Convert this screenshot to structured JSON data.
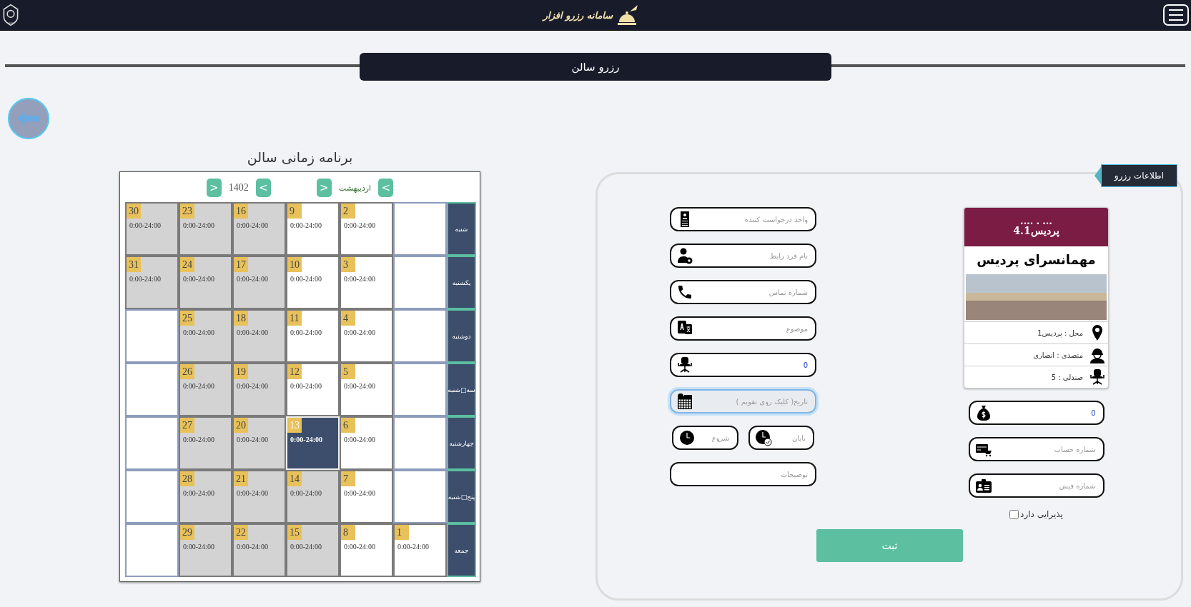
{
  "header": {
    "title": "سامانه رزرو افزار"
  },
  "page_title": "رزرو سالن",
  "schedule": {
    "title": "برنامه زمانی سالن",
    "month_picker": {
      "start_button": ">",
      "label": "اردیبهشت",
      "end_button": "<"
    },
    "year_picker": {
      "start_button": ">",
      "label": "1402",
      "end_button": "<"
    },
    "rows": [
      {
        "day_name": "شنبه",
        "cells": [
          {
            "kind": "blank"
          },
          {
            "kind": "day",
            "day": "2",
            "hours": "0:00-24:00",
            "past": false,
            "selected": false
          },
          {
            "kind": "day",
            "day": "9",
            "hours": "0:00-24:00",
            "past": false,
            "selected": false
          },
          {
            "kind": "day",
            "day": "16",
            "hours": "0:00-24:00",
            "past": true,
            "selected": false
          },
          {
            "kind": "day",
            "day": "23",
            "hours": "0:00-24:00",
            "past": true,
            "selected": false
          },
          {
            "kind": "day",
            "day": "30",
            "hours": "0:00-24:00",
            "past": true,
            "selected": false
          }
        ]
      },
      {
        "day_name": "یکشنبه",
        "cells": [
          {
            "kind": "blank"
          },
          {
            "kind": "day",
            "day": "3",
            "hours": "0:00-24:00",
            "past": false,
            "selected": false
          },
          {
            "kind": "day",
            "day": "10",
            "hours": "0:00-24:00",
            "past": false,
            "selected": false
          },
          {
            "kind": "day",
            "day": "17",
            "hours": "0:00-24:00",
            "past": true,
            "selected": false
          },
          {
            "kind": "day",
            "day": "24",
            "hours": "0:00-24:00",
            "past": true,
            "selected": false
          },
          {
            "kind": "day",
            "day": "31",
            "hours": "0:00-24:00",
            "past": true,
            "selected": false
          }
        ]
      },
      {
        "day_name": "دوشنبه",
        "cells": [
          {
            "kind": "blank"
          },
          {
            "kind": "day",
            "day": "4",
            "hours": "0:00-24:00",
            "past": false,
            "selected": false
          },
          {
            "kind": "day",
            "day": "11",
            "hours": "0:00-24:00",
            "past": false,
            "selected": false
          },
          {
            "kind": "day",
            "day": "18",
            "hours": "0:00-24:00",
            "past": true,
            "selected": false
          },
          {
            "kind": "day",
            "day": "25",
            "hours": "0:00-24:00",
            "past": true,
            "selected": false
          },
          {
            "kind": "blank"
          }
        ]
      },
      {
        "day_name": "سه□شنبه",
        "cells": [
          {
            "kind": "blank"
          },
          {
            "kind": "day",
            "day": "5",
            "hours": "0:00-24:00",
            "past": false,
            "selected": false
          },
          {
            "kind": "day",
            "day": "12",
            "hours": "0:00-24:00",
            "past": false,
            "selected": false
          },
          {
            "kind": "day",
            "day": "19",
            "hours": "0:00-24:00",
            "past": true,
            "selected": false
          },
          {
            "kind": "day",
            "day": "26",
            "hours": "0:00-24:00",
            "past": true,
            "selected": false
          },
          {
            "kind": "blank"
          }
        ]
      },
      {
        "day_name": "چهارشنبه",
        "cells": [
          {
            "kind": "blank"
          },
          {
            "kind": "day",
            "day": "6",
            "hours": "0:00-24:00",
            "past": false,
            "selected": false
          },
          {
            "kind": "day",
            "day": "13",
            "hours": "0:00-24:00",
            "past": false,
            "selected": true
          },
          {
            "kind": "day",
            "day": "20",
            "hours": "0:00-24:00",
            "past": true,
            "selected": false
          },
          {
            "kind": "day",
            "day": "27",
            "hours": "0:00-24:00",
            "past": true,
            "selected": false
          },
          {
            "kind": "blank"
          }
        ]
      },
      {
        "day_name": "پنج□شنبه",
        "cells": [
          {
            "kind": "blank"
          },
          {
            "kind": "day",
            "day": "7",
            "hours": "0:00-24:00",
            "past": false,
            "selected": false
          },
          {
            "kind": "day",
            "day": "14",
            "hours": "0:00-24:00",
            "past": true,
            "selected": false
          },
          {
            "kind": "day",
            "day": "21",
            "hours": "0:00-24:00",
            "past": true,
            "selected": false
          },
          {
            "kind": "day",
            "day": "28",
            "hours": "0:00-24:00",
            "past": true,
            "selected": false
          },
          {
            "kind": "blank"
          }
        ]
      },
      {
        "day_name": "جمعه",
        "cells": [
          {
            "kind": "day",
            "day": "1",
            "hours": "0:00-24:00",
            "past": false,
            "selected": false
          },
          {
            "kind": "day",
            "day": "8",
            "hours": "0:00-24:00",
            "past": false,
            "selected": false
          },
          {
            "kind": "day",
            "day": "15",
            "hours": "0:00-24:00",
            "past": true,
            "selected": false
          },
          {
            "kind": "day",
            "day": "22",
            "hours": "0:00-24:00",
            "past": true,
            "selected": false
          },
          {
            "kind": "day",
            "day": "29",
            "hours": "0:00-24:00",
            "past": true,
            "selected": false
          },
          {
            "kind": "blank"
          }
        ]
      }
    ]
  },
  "reservation": {
    "tab": "اطلاعات رزرو",
    "venue_card": {
      "code_dots": "... . ....",
      "code": "پردیس4.1",
      "name": "مهمانسرای پردیس",
      "details": [
        {
          "kind": "location",
          "text": "محل : پردیس1"
        },
        {
          "kind": "attendant",
          "text": "متصدی : انصاری"
        },
        {
          "kind": "seats",
          "text": "صندلی : 5"
        }
      ]
    },
    "side_fields": [
      {
        "kind": "amount",
        "value": "0"
      },
      {
        "kind": "account",
        "placeholder": "شماره حساب"
      },
      {
        "kind": "receipt",
        "placeholder": "شماره فیش"
      }
    ],
    "catering": {
      "label": "پذیرایی دارد",
      "checked": false
    },
    "form_fields": [
      {
        "kind": "unit",
        "placeholder": "واحد درخواست کننده"
      },
      {
        "kind": "contact",
        "placeholder": "نام فرد رابط"
      },
      {
        "kind": "phone",
        "placeholder": "شماره تماس"
      },
      {
        "kind": "subject",
        "placeholder": "موضوع"
      },
      {
        "kind": "seats",
        "value": "0"
      },
      {
        "kind": "date",
        "placeholder": "تاریخ( کلیک روی تقویم )",
        "focused": true
      },
      {
        "kind": "pair",
        "fields": [
          {
            "kind": "end",
            "placeholder": "پایان"
          },
          {
            "kind": "start",
            "placeholder": "شروع"
          }
        ]
      },
      {
        "kind": "notes",
        "placeholder": "توضیحات"
      }
    ],
    "submit": "ثبت"
  }
}
